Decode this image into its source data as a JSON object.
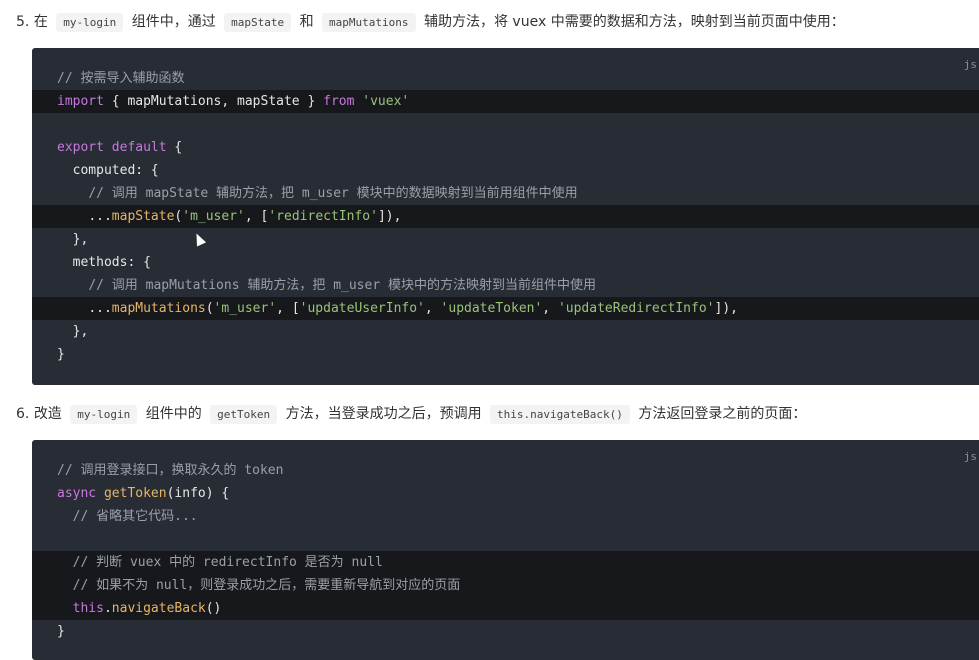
{
  "step5": {
    "number": "5.",
    "t1": "在",
    "code1": "my-login",
    "t2": "组件中，通过",
    "code2": "mapState",
    "t3": "和",
    "code3": "mapMutations",
    "t4": "辅助方法，将 vuex 中需要的数据和方法，映射到当前页面中使用："
  },
  "block1": {
    "lang": "js",
    "lines": [
      {
        "indent": "",
        "parts": [
          {
            "t": "// 按需导入辅助函数",
            "c": "cm"
          }
        ]
      },
      {
        "indent": "",
        "parts": [
          {
            "t": "import",
            "c": "kw"
          },
          {
            "t": " { mapMutations, mapState } ",
            "c": "pl"
          },
          {
            "t": "from",
            "c": "kw"
          },
          {
            "t": " ",
            "c": "pl"
          },
          {
            "t": "'vuex'",
            "c": "str"
          }
        ]
      },
      {
        "indent": "",
        "parts": []
      },
      {
        "indent": "",
        "parts": [
          {
            "t": "export default",
            "c": "kw"
          },
          {
            "t": " {",
            "c": "pl"
          }
        ]
      },
      {
        "indent": "  ",
        "parts": [
          {
            "t": "computed: {",
            "c": "pl"
          }
        ]
      },
      {
        "indent": "    ",
        "parts": [
          {
            "t": "// 调用 mapState 辅助方法，把 m_user 模块中的数据映射到当前用组件中使用",
            "c": "cm"
          }
        ]
      },
      {
        "indent": "    ",
        "parts": [
          {
            "t": "...",
            "c": "pl"
          },
          {
            "t": "mapState",
            "c": "fn"
          },
          {
            "t": "(",
            "c": "pl"
          },
          {
            "t": "'m_user'",
            "c": "str"
          },
          {
            "t": ", [",
            "c": "pl"
          },
          {
            "t": "'redirectInfo'",
            "c": "str"
          },
          {
            "t": "]),",
            "c": "pl"
          }
        ]
      },
      {
        "indent": "  ",
        "parts": [
          {
            "t": "},",
            "c": "pl"
          }
        ]
      },
      {
        "indent": "  ",
        "parts": [
          {
            "t": "methods: {",
            "c": "pl"
          }
        ]
      },
      {
        "indent": "    ",
        "parts": [
          {
            "t": "// 调用 mapMutations 辅助方法，把 m_user 模块中的方法映射到当前组件中使用",
            "c": "cm"
          }
        ]
      },
      {
        "indent": "    ",
        "parts": [
          {
            "t": "...",
            "c": "pl"
          },
          {
            "t": "mapMutations",
            "c": "fn"
          },
          {
            "t": "(",
            "c": "pl"
          },
          {
            "t": "'m_user'",
            "c": "str"
          },
          {
            "t": ", [",
            "c": "pl"
          },
          {
            "t": "'updateUserInfo'",
            "c": "str"
          },
          {
            "t": ", ",
            "c": "pl"
          },
          {
            "t": "'updateToken'",
            "c": "str"
          },
          {
            "t": ", ",
            "c": "pl"
          },
          {
            "t": "'updateRedirectInfo'",
            "c": "str"
          },
          {
            "t": "]),",
            "c": "pl"
          }
        ]
      },
      {
        "indent": "  ",
        "parts": [
          {
            "t": "},",
            "c": "pl"
          }
        ]
      },
      {
        "indent": "",
        "parts": [
          {
            "t": "}",
            "c": "pl"
          }
        ]
      }
    ]
  },
  "step6": {
    "number": "6.",
    "t1": "改造",
    "code1": "my-login",
    "t2": "组件中的",
    "code2": "getToken",
    "t3": "方法，当登录成功之后，预调用",
    "code3": "this.navigateBack()",
    "t4": "方法返回登录之前的页面："
  },
  "block2": {
    "lang": "js",
    "lines": [
      {
        "indent": "",
        "parts": [
          {
            "t": "// 调用登录接口，换取永久的 token",
            "c": "cm"
          }
        ]
      },
      {
        "indent": "",
        "parts": [
          {
            "t": "async",
            "c": "kw"
          },
          {
            "t": " ",
            "c": "pl"
          },
          {
            "t": "getToken",
            "c": "fn"
          },
          {
            "t": "(info) {",
            "c": "pl"
          }
        ]
      },
      {
        "indent": "  ",
        "parts": [
          {
            "t": "// 省略其它代码...",
            "c": "cm"
          }
        ]
      },
      {
        "indent": "",
        "parts": []
      },
      {
        "indent": "  ",
        "parts": [
          {
            "t": "// 判断 vuex 中的 redirectInfo 是否为 null",
            "c": "cm"
          }
        ]
      },
      {
        "indent": "  ",
        "parts": [
          {
            "t": "// 如果不为 null，则登录成功之后，需要重新导航到对应的页面",
            "c": "cm"
          }
        ]
      },
      {
        "indent": "  ",
        "parts": [
          {
            "t": "this",
            "c": "kw"
          },
          {
            "t": ".",
            "c": "pl"
          },
          {
            "t": "navigateBack",
            "c": "fn"
          },
          {
            "t": "()",
            "c": "pl"
          }
        ]
      },
      {
        "indent": "",
        "parts": [
          {
            "t": "}",
            "c": "pl"
          }
        ]
      }
    ]
  }
}
